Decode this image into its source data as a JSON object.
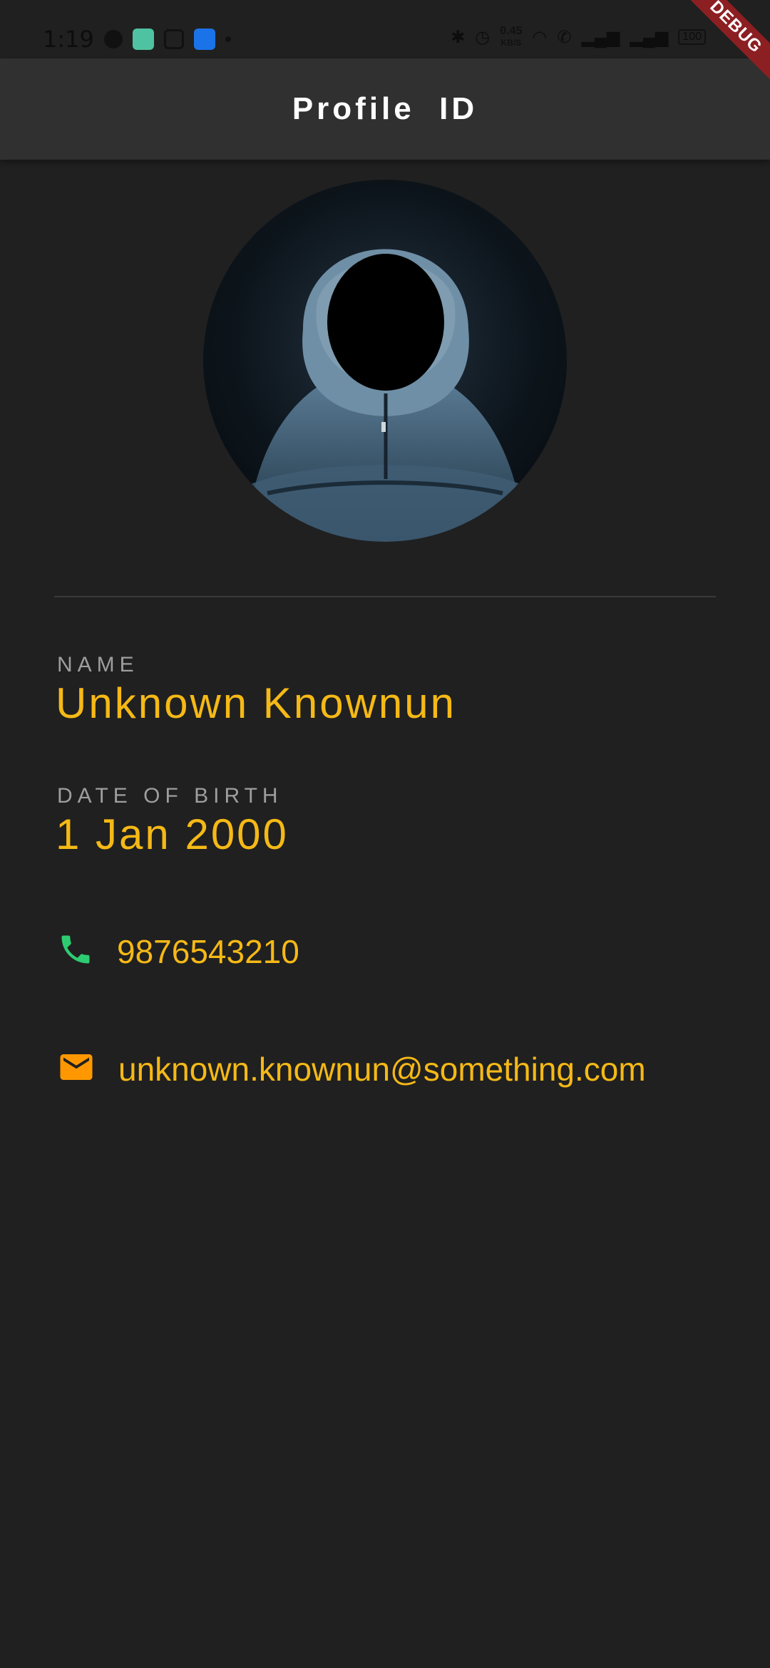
{
  "status_bar": {
    "time": "1:19",
    "net_speed_value": "0.45",
    "net_speed_unit": "KB/S",
    "battery": "100"
  },
  "app_bar": {
    "title": "Profile  ID"
  },
  "debug_banner": "DEBUG",
  "profile": {
    "name_label": "NAME",
    "name_value": "Unknown Knownun",
    "dob_label": "DATE OF BIRTH",
    "dob_value": "1 Jan 2000",
    "phone": "9876543210",
    "email": "unknown.knownun@something.com"
  },
  "icons": {
    "phone": "phone-icon",
    "email": "email-icon"
  },
  "colors": {
    "background": "#202020",
    "app_bar": "#303030",
    "accent": "#f5b916",
    "label": "#9e9e9e",
    "phone_icon": "#2ecc71",
    "email_icon": "#ff9800"
  }
}
